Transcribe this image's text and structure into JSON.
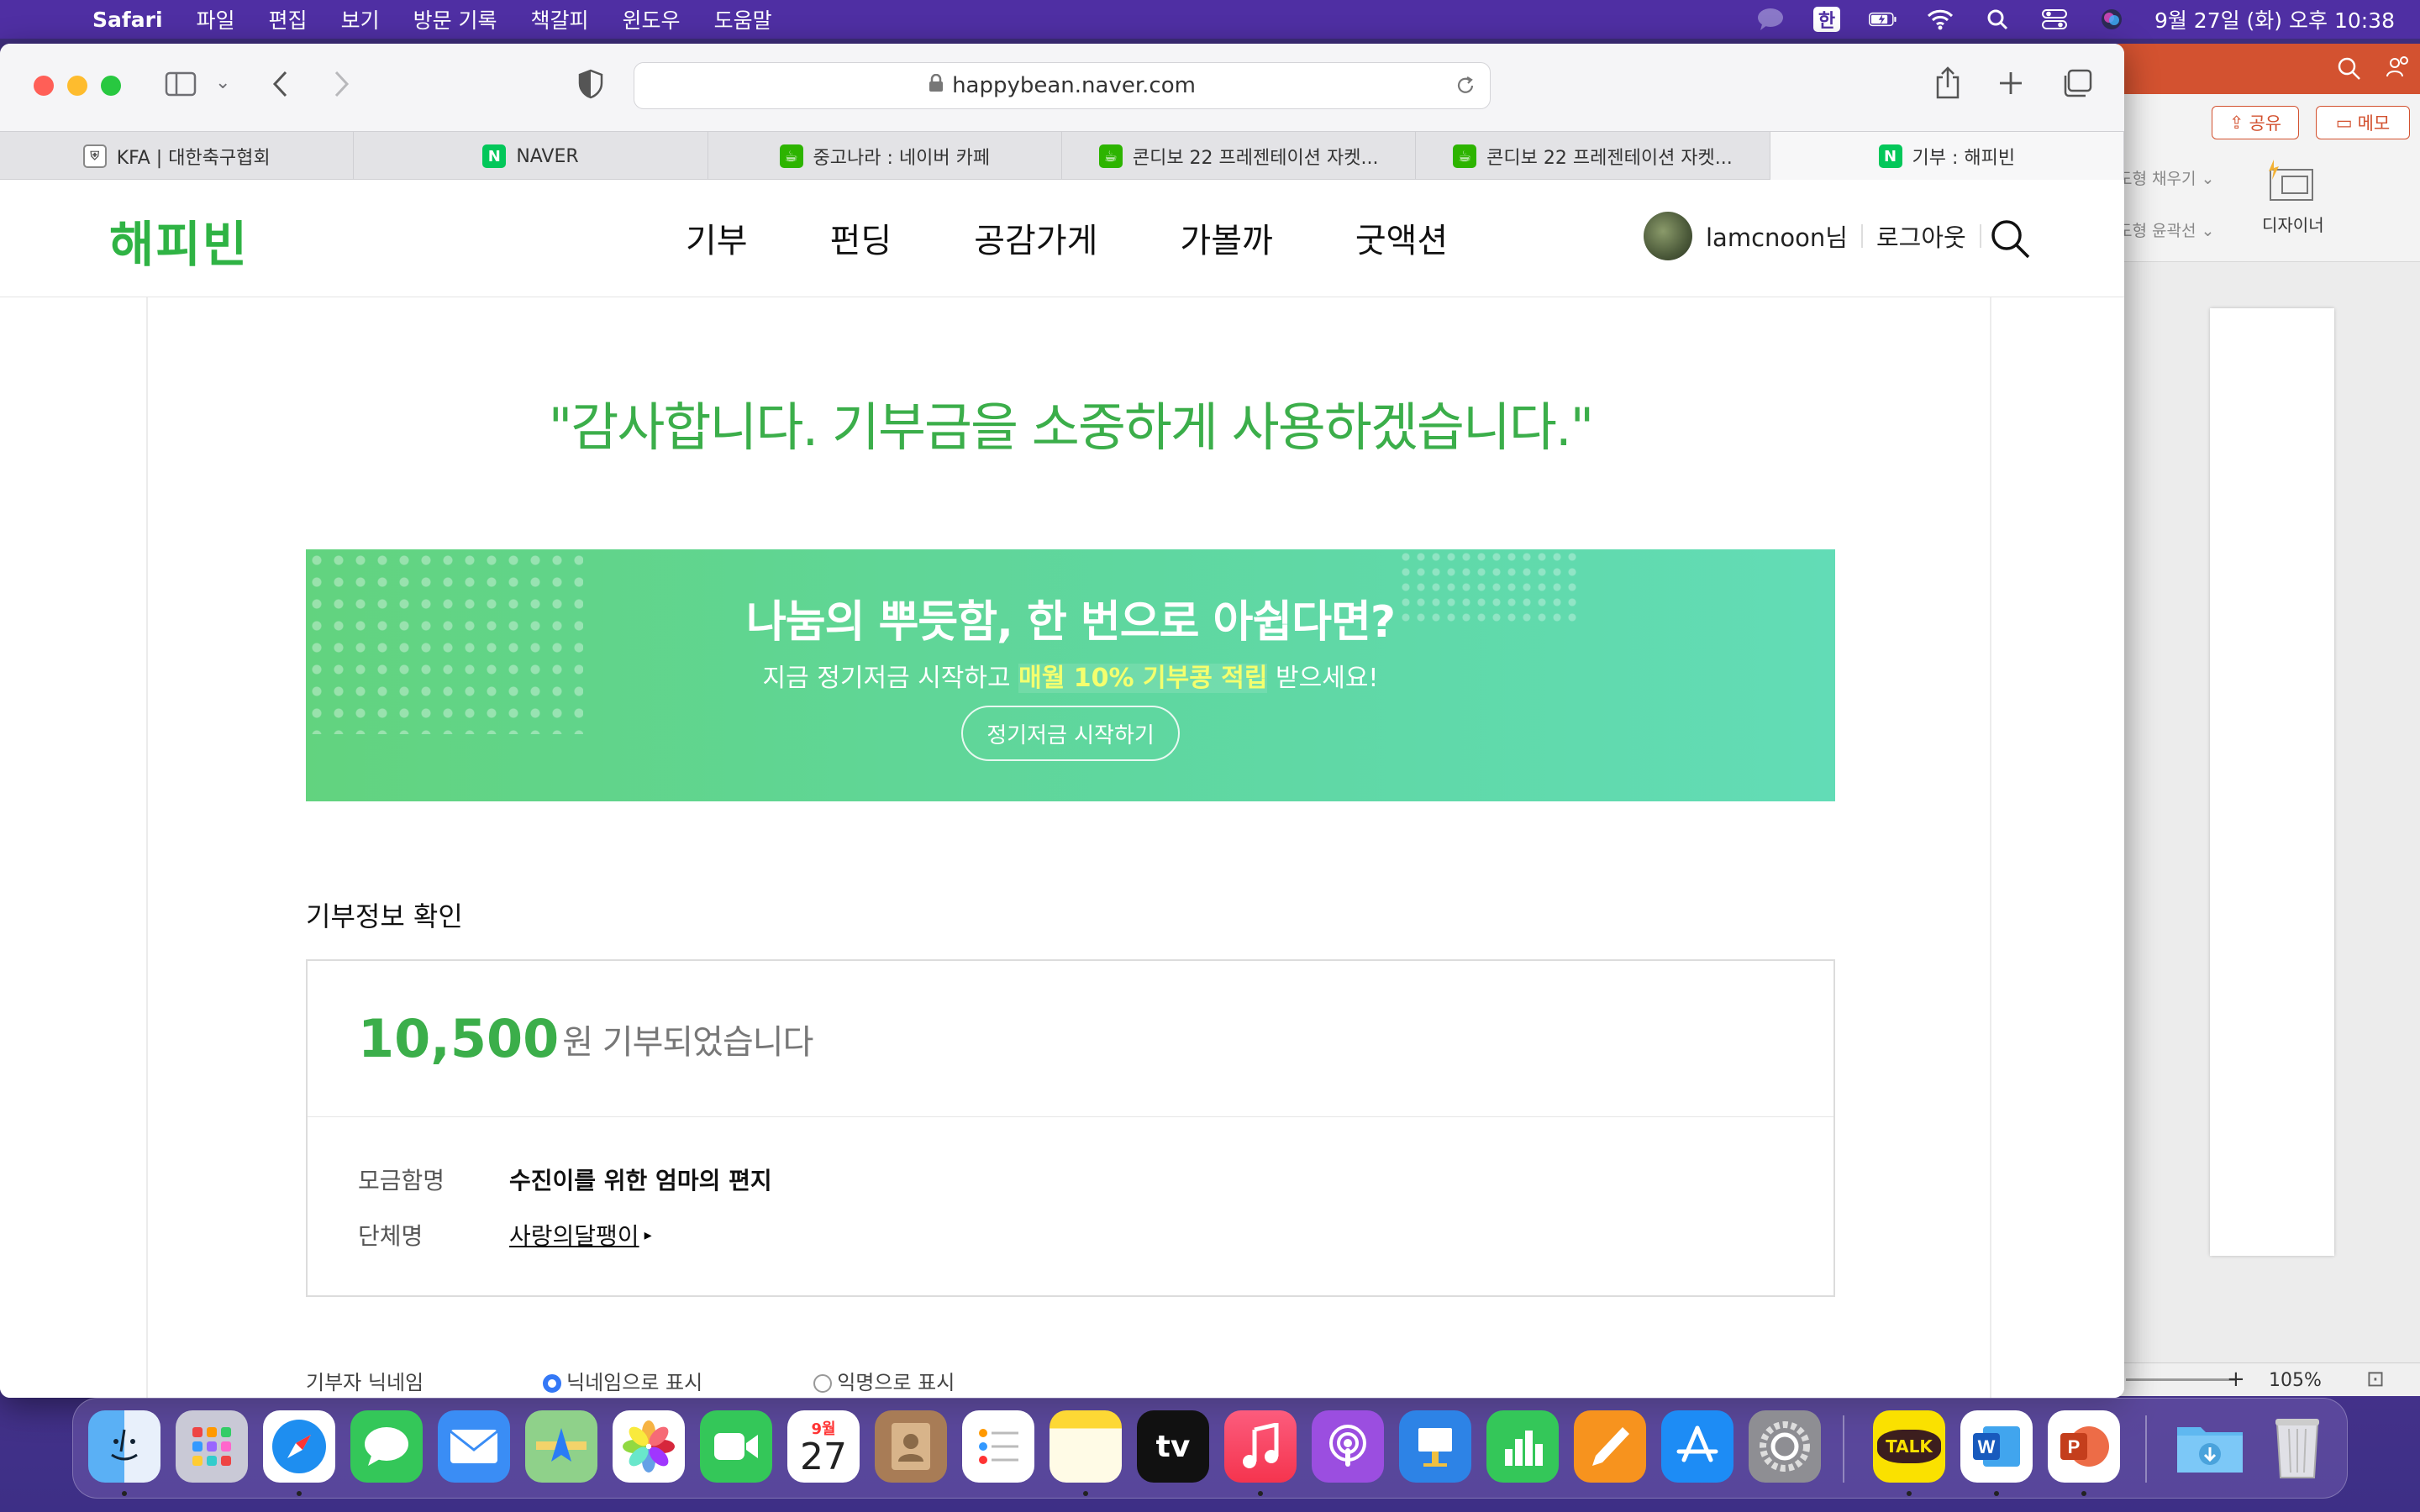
{
  "menubar": {
    "app_name": "Safari",
    "menus": [
      "파일",
      "편집",
      "보기",
      "방문 기록",
      "책갈피",
      "윈도우",
      "도움말"
    ],
    "input_method": "한",
    "datetime": "9월 27일 (화) 오후 10:38"
  },
  "safari": {
    "url": "happybean.naver.com",
    "tabs": [
      {
        "title": "KFA | 대한축구협회",
        "favicon": "kfa-icon"
      },
      {
        "title": "NAVER",
        "favicon": "naver-icon"
      },
      {
        "title": "중고나라 : 네이버 카페",
        "favicon": "cafe-icon"
      },
      {
        "title": "콘디보 22 프레젠테이션 자켓...",
        "favicon": "cafe-icon"
      },
      {
        "title": "콘디보 22 프레젠테이션 자켓...",
        "favicon": "cafe-icon"
      },
      {
        "title": "기부 : 해피빈",
        "favicon": "naver-icon",
        "active": true
      }
    ]
  },
  "site": {
    "logo": "해피빈",
    "nav": [
      "기부",
      "펀딩",
      "공감가게",
      "가볼까",
      "굿액션"
    ],
    "username": "lamcnoon님",
    "logout": "로그아웃"
  },
  "main": {
    "thanks": "\"감사합니다. 기부금을 소중하게 사용하겠습니다.\"",
    "banner": {
      "title": "나눔의 뿌듯함, 한 번으로 아쉽다면?",
      "sub_before": "지금 정기저금 시작하고 ",
      "sub_highlight": "매월 10% 기부콩 적립",
      "sub_after": " 받으세요!",
      "button": "정기저금 시작하기"
    },
    "section_title": "기부정보 확인",
    "amount": "10,500",
    "amount_suffix": "원 기부되었습니다",
    "fund_label": "모금함명",
    "fund_value": "수진이를 위한 엄마의 편지",
    "org_label": "단체명",
    "org_value": "사랑의달팽이",
    "nickname_label": "기부자 닉네임",
    "nickname_options": [
      "닉네임으로 표시",
      "익명으로 표시"
    ]
  },
  "ppt": {
    "share": "공유",
    "memo": "메모",
    "fill": "도형 채우기",
    "outline": "도형 윤곽선",
    "designer": "디자이너",
    "zoom": "105%"
  },
  "dock": {
    "calendar_month": "9월",
    "calendar_day": "27",
    "tv_label": "tv",
    "kakao_label": "TALK"
  },
  "colors": {
    "happybean_green": "#3bae4a",
    "banner_start": "#62d37f",
    "banner_end": "#62dcb6",
    "menubar": "#4f2fa3"
  }
}
